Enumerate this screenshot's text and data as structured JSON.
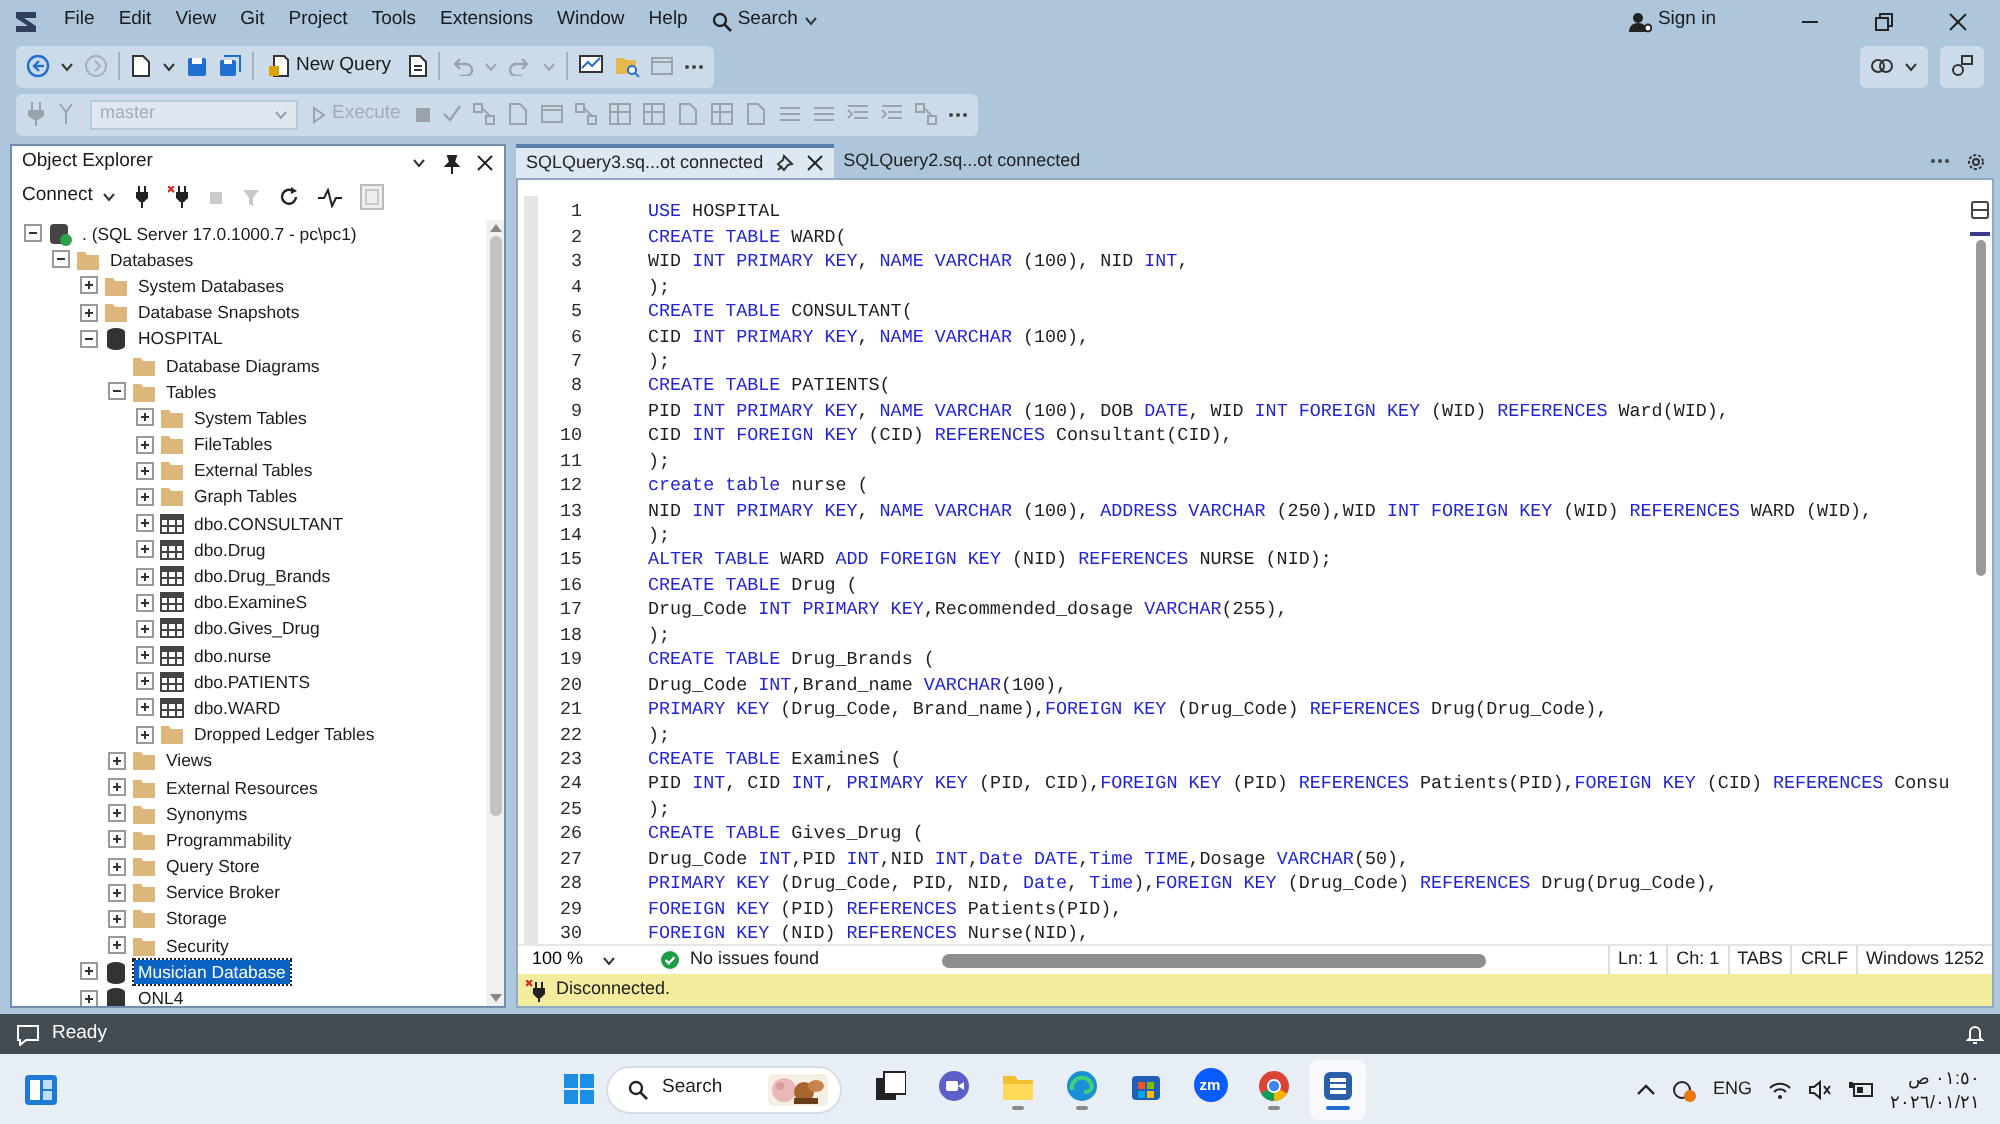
{
  "menu": {
    "items": [
      "File",
      "Edit",
      "View",
      "Git",
      "Project",
      "Tools",
      "Extensions",
      "Window",
      "Help"
    ],
    "search": "Search",
    "sign_in": "Sign in"
  },
  "toolbar": {
    "new_query": "New Query",
    "database": {
      "value": "master",
      "disabled": true
    },
    "execute": {
      "label": "Execute",
      "disabled": true
    }
  },
  "object_explorer": {
    "title": "Object Explorer",
    "connect": "Connect",
    "tree": [
      {
        "label": ". (SQL Server 17.0.1000.7 - pc\\pc1)",
        "kind": "server",
        "expanded": true,
        "selected": false,
        "children": [
          {
            "label": "Databases",
            "kind": "folder",
            "expanded": true,
            "selected": false,
            "children": [
              {
                "label": "System Databases",
                "kind": "folder",
                "expanded": false,
                "selected": false
              },
              {
                "label": "Database Snapshots",
                "kind": "folder",
                "expanded": false,
                "selected": false
              },
              {
                "label": "HOSPITAL",
                "kind": "database",
                "expanded": true,
                "selected": false,
                "children": [
                  {
                    "label": "Database Diagrams",
                    "kind": "folder",
                    "selected": false
                  },
                  {
                    "label": "Tables",
                    "kind": "folder",
                    "expanded": true,
                    "selected": false,
                    "children": [
                      {
                        "label": "System Tables",
                        "kind": "folder",
                        "expanded": false,
                        "selected": false
                      },
                      {
                        "label": "FileTables",
                        "kind": "folder",
                        "expanded": false,
                        "selected": false
                      },
                      {
                        "label": "External Tables",
                        "kind": "folder",
                        "expanded": false,
                        "selected": false
                      },
                      {
                        "label": "Graph Tables",
                        "kind": "folder",
                        "expanded": false,
                        "selected": false
                      },
                      {
                        "label": "dbo.CONSULTANT",
                        "kind": "table",
                        "expanded": false,
                        "selected": false
                      },
                      {
                        "label": "dbo.Drug",
                        "kind": "table",
                        "expanded": false,
                        "selected": false
                      },
                      {
                        "label": "dbo.Drug_Brands",
                        "kind": "table",
                        "expanded": false,
                        "selected": false
                      },
                      {
                        "label": "dbo.ExamineS",
                        "kind": "table",
                        "expanded": false,
                        "selected": false
                      },
                      {
                        "label": "dbo.Gives_Drug",
                        "kind": "table",
                        "expanded": false,
                        "selected": false
                      },
                      {
                        "label": "dbo.nurse",
                        "kind": "table",
                        "expanded": false,
                        "selected": false
                      },
                      {
                        "label": "dbo.PATIENTS",
                        "kind": "table",
                        "expanded": false,
                        "selected": false
                      },
                      {
                        "label": "dbo.WARD",
                        "kind": "table",
                        "expanded": false,
                        "selected": false
                      },
                      {
                        "label": "Dropped Ledger Tables",
                        "kind": "folder",
                        "expanded": false,
                        "selected": false
                      }
                    ]
                  },
                  {
                    "label": "Views",
                    "kind": "folder",
                    "expanded": false,
                    "selected": false
                  },
                  {
                    "label": "External Resources",
                    "kind": "folder",
                    "expanded": false,
                    "selected": false
                  },
                  {
                    "label": "Synonyms",
                    "kind": "folder",
                    "expanded": false,
                    "selected": false
                  },
                  {
                    "label": "Programmability",
                    "kind": "folder",
                    "expanded": false,
                    "selected": false
                  },
                  {
                    "label": "Query Store",
                    "kind": "folder",
                    "expanded": false,
                    "selected": false
                  },
                  {
                    "label": "Service Broker",
                    "kind": "folder",
                    "expanded": false,
                    "selected": false
                  },
                  {
                    "label": "Storage",
                    "kind": "folder",
                    "expanded": false,
                    "selected": false
                  },
                  {
                    "label": "Security",
                    "kind": "folder",
                    "expanded": false,
                    "selected": false
                  }
                ]
              },
              {
                "label": "Musician Database",
                "kind": "database",
                "expanded": false,
                "selected": true
              },
              {
                "label": "ONL4",
                "kind": "database",
                "expanded": false,
                "selected": false
              }
            ]
          }
        ]
      }
    ]
  },
  "editor": {
    "tabs": [
      {
        "label": "SQLQuery3.sq...ot connected",
        "selected": true
      },
      {
        "label": "SQLQuery2.sq...ot connected",
        "selected": false
      }
    ],
    "lines": [
      {
        "number": "1",
        "tokens": [
          {
            "kind": "keyword",
            "text": "USE"
          },
          {
            "kind": "plain",
            "text": " HOSPITAL"
          }
        ]
      },
      {
        "number": "2",
        "tokens": [
          {
            "kind": "keyword",
            "text": "CREATE TABLE"
          },
          {
            "kind": "plain",
            "text": " WARD("
          }
        ]
      },
      {
        "number": "3",
        "tokens": [
          {
            "kind": "plain",
            "text": "WID "
          },
          {
            "kind": "keyword",
            "text": "INT PRIMARY KEY"
          },
          {
            "kind": "plain",
            "text": ", "
          },
          {
            "kind": "keyword",
            "text": "NAME VARCHAR"
          },
          {
            "kind": "plain",
            "text": " (100), NID "
          },
          {
            "kind": "keyword",
            "text": "INT"
          },
          {
            "kind": "plain",
            "text": ","
          }
        ]
      },
      {
        "number": "4",
        "tokens": [
          {
            "kind": "plain",
            "text": ");"
          }
        ]
      },
      {
        "number": "5",
        "tokens": [
          {
            "kind": "keyword",
            "text": "CREATE TABLE"
          },
          {
            "kind": "plain",
            "text": " CONSULTANT("
          }
        ]
      },
      {
        "number": "6",
        "tokens": [
          {
            "kind": "plain",
            "text": "CID "
          },
          {
            "kind": "keyword",
            "text": "INT PRIMARY KEY"
          },
          {
            "kind": "plain",
            "text": ", "
          },
          {
            "kind": "keyword",
            "text": "NAME VARCHAR"
          },
          {
            "kind": "plain",
            "text": " (100),"
          }
        ]
      },
      {
        "number": "7",
        "tokens": [
          {
            "kind": "plain",
            "text": ");"
          }
        ]
      },
      {
        "number": "8",
        "tokens": [
          {
            "kind": "keyword",
            "text": "CREATE TABLE"
          },
          {
            "kind": "plain",
            "text": " PATIENTS("
          }
        ]
      },
      {
        "number": "9",
        "tokens": [
          {
            "kind": "plain",
            "text": "PID "
          },
          {
            "kind": "keyword",
            "text": "INT PRIMARY KEY"
          },
          {
            "kind": "plain",
            "text": ", "
          },
          {
            "kind": "keyword",
            "text": "NAME VARCHAR"
          },
          {
            "kind": "plain",
            "text": " (100), DOB "
          },
          {
            "kind": "keyword",
            "text": "DATE"
          },
          {
            "kind": "plain",
            "text": ", WID "
          },
          {
            "kind": "keyword",
            "text": "INT FOREIGN KEY"
          },
          {
            "kind": "plain",
            "text": " (WID) "
          },
          {
            "kind": "keyword",
            "text": "REFERENCES"
          },
          {
            "kind": "plain",
            "text": " Ward(WID),"
          }
        ]
      },
      {
        "number": "10",
        "tokens": [
          {
            "kind": "plain",
            "text": "CID "
          },
          {
            "kind": "keyword",
            "text": "INT FOREIGN KEY"
          },
          {
            "kind": "plain",
            "text": " (CID) "
          },
          {
            "kind": "keyword",
            "text": "REFERENCES"
          },
          {
            "kind": "plain",
            "text": " Consultant(CID),"
          }
        ]
      },
      {
        "number": "11",
        "tokens": [
          {
            "kind": "plain",
            "text": ");"
          }
        ]
      },
      {
        "number": "12",
        "tokens": [
          {
            "kind": "keyword",
            "text": "create table"
          },
          {
            "kind": "plain",
            "text": " nurse ("
          }
        ]
      },
      {
        "number": "13",
        "tokens": [
          {
            "kind": "plain",
            "text": "NID "
          },
          {
            "kind": "keyword",
            "text": "INT PRIMARY KEY"
          },
          {
            "kind": "plain",
            "text": ", "
          },
          {
            "kind": "keyword",
            "text": "NAME VARCHAR"
          },
          {
            "kind": "plain",
            "text": " (100), "
          },
          {
            "kind": "keyword",
            "text": "ADDRESS VARCHAR"
          },
          {
            "kind": "plain",
            "text": " (250),WID "
          },
          {
            "kind": "keyword",
            "text": "INT FOREIGN KEY"
          },
          {
            "kind": "plain",
            "text": " (WID) "
          },
          {
            "kind": "keyword",
            "text": "REFERENCES"
          },
          {
            "kind": "plain",
            "text": " WARD (WID),"
          }
        ]
      },
      {
        "number": "14",
        "tokens": [
          {
            "kind": "plain",
            "text": ");"
          }
        ]
      },
      {
        "number": "15",
        "tokens": [
          {
            "kind": "keyword",
            "text": "ALTER TABLE"
          },
          {
            "kind": "plain",
            "text": " WARD "
          },
          {
            "kind": "keyword",
            "text": "ADD FOREIGN KEY"
          },
          {
            "kind": "plain",
            "text": " (NID) "
          },
          {
            "kind": "keyword",
            "text": "REFERENCES"
          },
          {
            "kind": "plain",
            "text": " NURSE (NID);"
          }
        ]
      },
      {
        "number": "16",
        "tokens": [
          {
            "kind": "keyword",
            "text": "CREATE TABLE"
          },
          {
            "kind": "plain",
            "text": " Drug ("
          }
        ]
      },
      {
        "number": "17",
        "tokens": [
          {
            "kind": "plain",
            "text": "Drug_Code "
          },
          {
            "kind": "keyword",
            "text": "INT PRIMARY KEY"
          },
          {
            "kind": "plain",
            "text": ",Recommended_dosage "
          },
          {
            "kind": "keyword",
            "text": "VARCHAR"
          },
          {
            "kind": "plain",
            "text": "(255),"
          }
        ]
      },
      {
        "number": "18",
        "tokens": [
          {
            "kind": "plain",
            "text": ");"
          }
        ]
      },
      {
        "number": "19",
        "tokens": [
          {
            "kind": "keyword",
            "text": "CREATE TABLE"
          },
          {
            "kind": "plain",
            "text": " Drug_Brands ("
          }
        ]
      },
      {
        "number": "20",
        "tokens": [
          {
            "kind": "plain",
            "text": "Drug_Code "
          },
          {
            "kind": "keyword",
            "text": "INT"
          },
          {
            "kind": "plain",
            "text": ",Brand_name "
          },
          {
            "kind": "keyword",
            "text": "VARCHAR"
          },
          {
            "kind": "plain",
            "text": "(100),"
          }
        ]
      },
      {
        "number": "21",
        "tokens": [
          {
            "kind": "keyword",
            "text": "PRIMARY KEY"
          },
          {
            "kind": "plain",
            "text": " (Drug_Code, Brand_name),"
          },
          {
            "kind": "keyword",
            "text": "FOREIGN KEY"
          },
          {
            "kind": "plain",
            "text": " (Drug_Code) "
          },
          {
            "kind": "keyword",
            "text": "REFERENCES"
          },
          {
            "kind": "plain",
            "text": " Drug(Drug_Code),"
          }
        ]
      },
      {
        "number": "22",
        "tokens": [
          {
            "kind": "plain",
            "text": ");"
          }
        ]
      },
      {
        "number": "23",
        "tokens": [
          {
            "kind": "keyword",
            "text": "CREATE TABLE"
          },
          {
            "kind": "plain",
            "text": " ExamineS ("
          }
        ]
      },
      {
        "number": "24",
        "tokens": [
          {
            "kind": "plain",
            "text": "PID "
          },
          {
            "kind": "keyword",
            "text": "INT"
          },
          {
            "kind": "plain",
            "text": ", CID "
          },
          {
            "kind": "keyword",
            "text": "INT"
          },
          {
            "kind": "plain",
            "text": ", "
          },
          {
            "kind": "keyword",
            "text": "PRIMARY KEY"
          },
          {
            "kind": "plain",
            "text": " (PID, CID),"
          },
          {
            "kind": "keyword",
            "text": "FOREIGN KEY"
          },
          {
            "kind": "plain",
            "text": " (PID) "
          },
          {
            "kind": "keyword",
            "text": "REFERENCES"
          },
          {
            "kind": "plain",
            "text": " Patients(PID),"
          },
          {
            "kind": "keyword",
            "text": "FOREIGN KEY"
          },
          {
            "kind": "plain",
            "text": " (CID) "
          },
          {
            "kind": "keyword",
            "text": "REFERENCES"
          },
          {
            "kind": "plain",
            "text": " Consu"
          }
        ]
      },
      {
        "number": "25",
        "tokens": [
          {
            "kind": "plain",
            "text": ");"
          }
        ]
      },
      {
        "number": "26",
        "tokens": [
          {
            "kind": "keyword",
            "text": "CREATE TABLE"
          },
          {
            "kind": "plain",
            "text": " Gives_Drug ("
          }
        ]
      },
      {
        "number": "27",
        "tokens": [
          {
            "kind": "plain",
            "text": "Drug_Code "
          },
          {
            "kind": "keyword",
            "text": "INT"
          },
          {
            "kind": "plain",
            "text": ",PID "
          },
          {
            "kind": "keyword",
            "text": "INT"
          },
          {
            "kind": "plain",
            "text": ",NID "
          },
          {
            "kind": "keyword",
            "text": "INT"
          },
          {
            "kind": "plain",
            "text": ","
          },
          {
            "kind": "keyword",
            "text": "Date DATE"
          },
          {
            "kind": "plain",
            "text": ","
          },
          {
            "kind": "keyword",
            "text": "Time TIME"
          },
          {
            "kind": "plain",
            "text": ",Dosage "
          },
          {
            "kind": "keyword",
            "text": "VARCHAR"
          },
          {
            "kind": "plain",
            "text": "(50),"
          }
        ]
      },
      {
        "number": "28",
        "tokens": [
          {
            "kind": "keyword",
            "text": "PRIMARY KEY"
          },
          {
            "kind": "plain",
            "text": " (Drug_Code, PID, NID, "
          },
          {
            "kind": "keyword",
            "text": "Date"
          },
          {
            "kind": "plain",
            "text": ", "
          },
          {
            "kind": "keyword",
            "text": "Time"
          },
          {
            "kind": "plain",
            "text": "),"
          },
          {
            "kind": "keyword",
            "text": "FOREIGN KEY"
          },
          {
            "kind": "plain",
            "text": " (Drug_Code) "
          },
          {
            "kind": "keyword",
            "text": "REFERENCES"
          },
          {
            "kind": "plain",
            "text": " Drug(Drug_Code),"
          }
        ]
      },
      {
        "number": "29",
        "tokens": [
          {
            "kind": "keyword",
            "text": "FOREIGN KEY"
          },
          {
            "kind": "plain",
            "text": " (PID) "
          },
          {
            "kind": "keyword",
            "text": "REFERENCES"
          },
          {
            "kind": "plain",
            "text": " Patients(PID),"
          }
        ]
      },
      {
        "number": "30",
        "tokens": [
          {
            "kind": "keyword",
            "text": "FOREIGN KEY"
          },
          {
            "kind": "plain",
            "text": " (NID) "
          },
          {
            "kind": "keyword",
            "text": "REFERENCES"
          },
          {
            "kind": "plain",
            "text": " Nurse(NID),"
          }
        ]
      }
    ],
    "zoom": "100 %",
    "issues": "No issues found",
    "status_items": [
      "Ln: 1",
      "Ch: 1",
      "TABS",
      "CRLF",
      "Windows 1252"
    ],
    "connection": "Disconnected."
  },
  "status_bar": {
    "text": "Ready"
  },
  "taskbar": {
    "search": "Search",
    "apps": [
      {
        "kind": "task_view",
        "running": false,
        "active": false
      },
      {
        "kind": "meet",
        "running": false,
        "active": false
      },
      {
        "kind": "explorer",
        "running": true,
        "active": false
      },
      {
        "kind": "edge",
        "running": true,
        "active": false
      },
      {
        "kind": "store",
        "running": false,
        "active": false
      },
      {
        "kind": "zoom",
        "label": "zm",
        "running": false,
        "active": false
      },
      {
        "kind": "chrome",
        "running": true,
        "active": false
      },
      {
        "kind": "ssms",
        "running": true,
        "active": true
      }
    ],
    "language": "ENG",
    "time": "٠١:٥٠ ص",
    "date": "٢٠٢٦/٠١/٢١"
  }
}
